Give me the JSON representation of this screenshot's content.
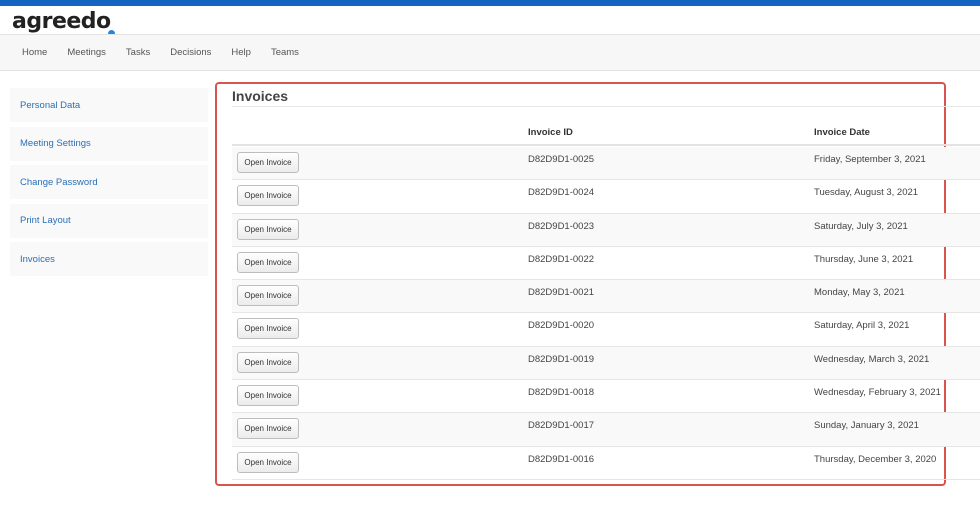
{
  "brand": {
    "name": "agreedo",
    "accent_color": "#1e88e5"
  },
  "topbar_color": "#1565c0",
  "nav": [
    "Home",
    "Meetings",
    "Tasks",
    "Decisions",
    "Help",
    "Teams"
  ],
  "sidebar": [
    "Personal Data",
    "Meeting Settings",
    "Change Password",
    "Print Layout",
    "Invoices"
  ],
  "invoices": {
    "title": "Invoices",
    "columns": {
      "id": "Invoice ID",
      "date": "Invoice Date"
    },
    "button_label": "Open Invoice",
    "rows": [
      {
        "id": "D82D9D1-0025",
        "date": "Friday, September 3, 2021"
      },
      {
        "id": "D82D9D1-0024",
        "date": "Tuesday, August 3, 2021"
      },
      {
        "id": "D82D9D1-0023",
        "date": "Saturday, July 3, 2021"
      },
      {
        "id": "D82D9D1-0022",
        "date": "Thursday, June 3, 2021"
      },
      {
        "id": "D82D9D1-0021",
        "date": "Monday, May 3, 2021"
      },
      {
        "id": "D82D9D1-0020",
        "date": "Saturday, April 3, 2021"
      },
      {
        "id": "D82D9D1-0019",
        "date": "Wednesday, March 3, 2021"
      },
      {
        "id": "D82D9D1-0018",
        "date": "Wednesday, February 3, 2021"
      },
      {
        "id": "D82D9D1-0017",
        "date": "Sunday, January 3, 2021"
      },
      {
        "id": "D82D9D1-0016",
        "date": "Thursday, December 3, 2020"
      }
    ]
  },
  "highlight_color": "#d9534f"
}
